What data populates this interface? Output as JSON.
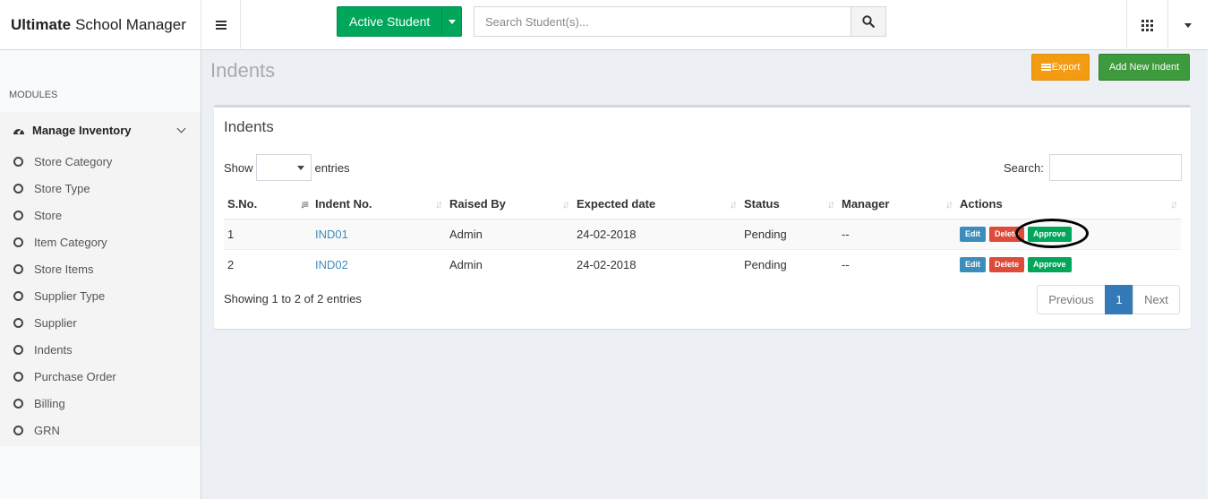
{
  "header": {
    "brand_bold": "Ultimate",
    "brand_rest": "School Manager",
    "active_button": "Active Student",
    "search_placeholder": "Search Student(s)..."
  },
  "sidebar": {
    "modules_label": "MODULES",
    "section_title": "Manage Inventory",
    "items": [
      {
        "label": "Store Category"
      },
      {
        "label": "Store Type"
      },
      {
        "label": "Store"
      },
      {
        "label": "Item Category"
      },
      {
        "label": "Store Items"
      },
      {
        "label": "Supplier Type"
      },
      {
        "label": "Supplier"
      },
      {
        "label": "Indents"
      },
      {
        "label": "Purchase Order"
      },
      {
        "label": "Billing"
      },
      {
        "label": "GRN"
      }
    ]
  },
  "main": {
    "page_title": "Indents",
    "export_label": "Export",
    "add_label": "Add New Indent",
    "box_title": "Indents",
    "show_label": "Show",
    "entries_label": "entries",
    "search_label": "Search:",
    "table": {
      "headers": [
        "S.No.",
        "Indent No.",
        "Raised By",
        "Expected date",
        "Status",
        "Manager",
        "Actions"
      ],
      "rows": [
        {
          "sno": "1",
          "indent": "IND01",
          "raised_by": "Admin",
          "date": "24-02-2018",
          "status": "Pending",
          "manager": "--"
        },
        {
          "sno": "2",
          "indent": "IND02",
          "raised_by": "Admin",
          "date": "24-02-2018",
          "status": "Pending",
          "manager": "--"
        }
      ],
      "actions": {
        "edit": "Edit",
        "delete": "Delete",
        "approve": "Approve"
      }
    },
    "info": "Showing 1 to 2 of 2 entries",
    "pager": {
      "previous": "Previous",
      "current": "1",
      "next": "Next"
    }
  }
}
